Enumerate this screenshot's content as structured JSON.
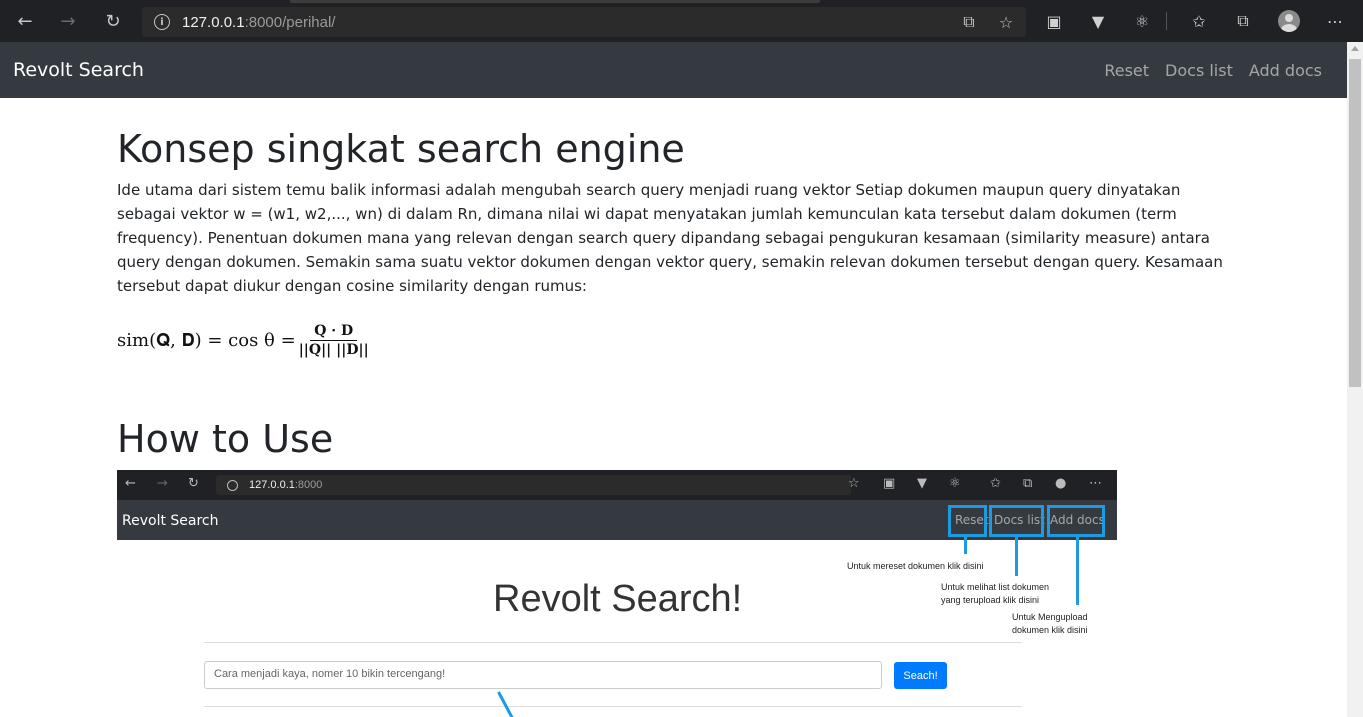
{
  "browser": {
    "url_host": "127.0.0.1",
    "url_rest": ":8000/perihal/",
    "icons": [
      "back-icon",
      "forward-icon",
      "refresh-icon",
      "info-icon",
      "translate-icon",
      "star-icon",
      "extension-icon",
      "vue-icon",
      "react-icon",
      "favorites-icon",
      "collections-icon",
      "profile-icon",
      "more-icon"
    ]
  },
  "navbar": {
    "brand": "Revolt Search",
    "links": [
      "Reset",
      "Docs list",
      "Add docs"
    ]
  },
  "main": {
    "title": "Konsep singkat search engine",
    "paragraph": "Ide utama dari sistem temu balik informasi adalah mengubah search query menjadi ruang vektor Setiap dokumen maupun query dinyatakan sebagai vektor w = (w1, w2,..., wn) di dalam Rn, dimana nilai wi dapat menyatakan jumlah kemunculan kata tersebut dalam dokumen (term frequency). Penentuan dokumen mana yang relevan dengan search query dipandang sebagai pengukuran kesamaan (similarity measure) antara query dengan dokumen. Semakin sama suatu vektor dokumen dengan vektor query, semakin relevan dokumen tersebut dengan query. Kesamaan tersebut dapat diukur dengan cosine similarity dengan rumus:",
    "formula_lhs": "sim(𝐐, 𝐃) =  cos θ =",
    "formula_num": "Q · D",
    "formula_den": "||Q|| ||D||",
    "howto_title": "How to Use"
  },
  "screenshot": {
    "url_host": "127.0.0.1",
    "url_rest": ":8000",
    "brand": "Revolt Search",
    "links": [
      "Reset",
      "Docs list",
      "Add docs"
    ],
    "note_reset": "Untuk mereset dokumen klik disini",
    "note_docs_1": "Untuk melihat list dokumen",
    "note_docs_2": "yang terupload klik disini",
    "note_add_1": "Untuk Mengupload",
    "note_add_2": "dokumen klik disini",
    "hero": "Revolt Search!",
    "search_placeholder": "Cara menjadi kaya, nomer 10 bikin tercengang!",
    "search_button": "Seach!"
  },
  "colors": {
    "navbar": "#343a40",
    "accent": "#1e9be0",
    "button": "#007bff"
  }
}
